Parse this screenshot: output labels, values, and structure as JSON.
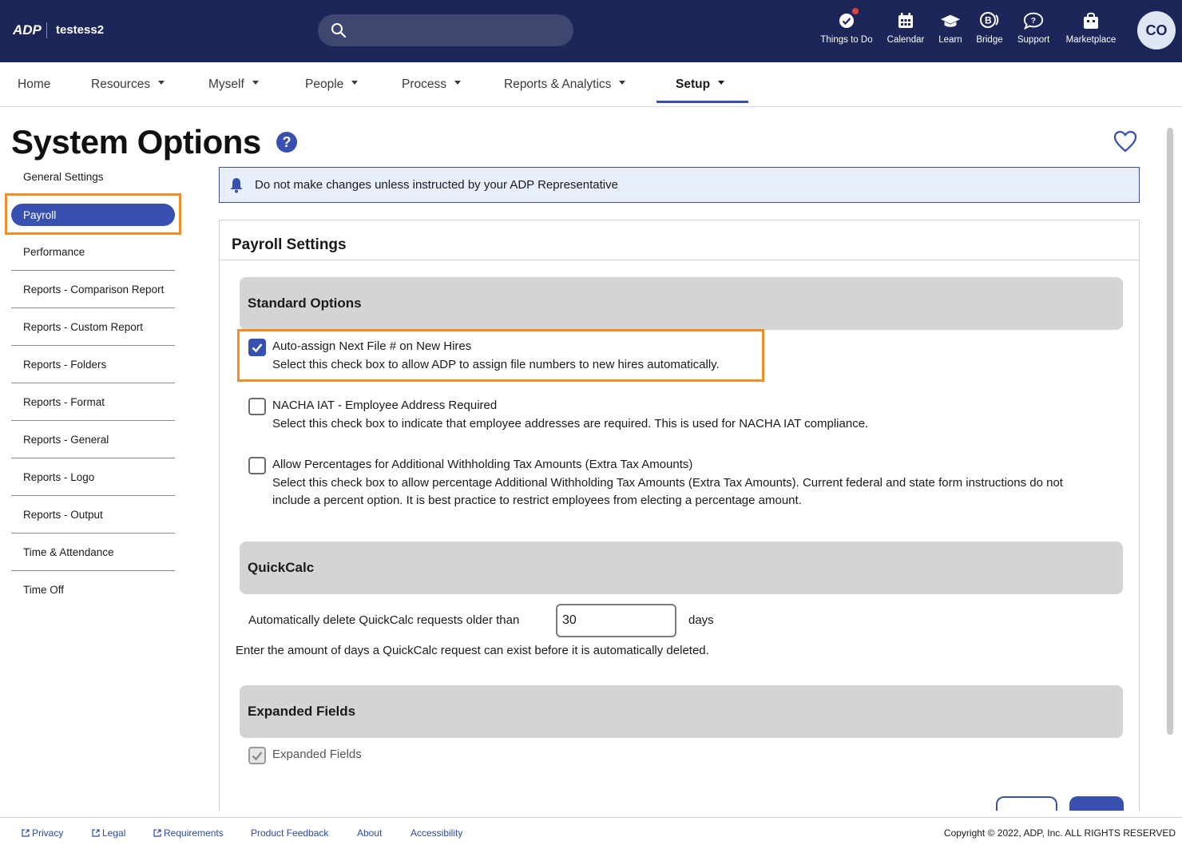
{
  "header": {
    "logo": "ADP",
    "tenant": "testess2",
    "search_placeholder": "",
    "nav": [
      {
        "label": "Things to Do",
        "icon": "things-to-do-icon"
      },
      {
        "label": "Calendar",
        "icon": "calendar-icon"
      },
      {
        "label": "Learn",
        "icon": "graduation-cap-icon"
      },
      {
        "label": "Bridge",
        "icon": "bridge-icon"
      },
      {
        "label": "Support",
        "icon": "support-icon"
      },
      {
        "label": "Marketplace",
        "icon": "marketplace-icon"
      }
    ],
    "avatar": "CO"
  },
  "mainnav": {
    "items": [
      "Home",
      "Resources",
      "Myself",
      "People",
      "Process",
      "Reports & Analytics",
      "Setup"
    ],
    "active": "Setup"
  },
  "page": {
    "title": "System Options",
    "help_icon": "?"
  },
  "sidebar": {
    "items": [
      "General Settings",
      "Payroll",
      "Performance",
      "Reports - Comparison Report",
      "Reports - Custom Report",
      "Reports - Folders",
      "Reports - Format",
      "Reports - General",
      "Reports - Logo",
      "Reports - Output",
      "Time & Attendance",
      "Time Off"
    ],
    "active": "Payroll"
  },
  "alert": {
    "text": "Do not make changes unless instructed by your ADP Representative"
  },
  "panel": {
    "title": "Payroll Settings",
    "standard": {
      "heading": "Standard Options",
      "options": [
        {
          "title": "Auto-assign Next File # on New Hires",
          "desc": "Select this check box to allow ADP to assign file numbers to new hires automatically.",
          "checked": true
        },
        {
          "title": "NACHA IAT - Employee Address Required",
          "desc": "Select this check box to indicate that employee addresses are required. This is used for NACHA IAT compliance.",
          "checked": false
        },
        {
          "title": "Allow Percentages for Additional Withholding Tax Amounts (Extra Tax Amounts)",
          "desc": "Select this check box to allow percentage Additional Withholding Tax Amounts (Extra Tax Amounts). Current federal and state form instructions do not include a percent option. It is best practice to restrict employees from electing a percentage amount.",
          "checked": false
        }
      ]
    },
    "quickcalc": {
      "heading": "QuickCalc",
      "label": "Automatically delete QuickCalc requests older than",
      "value": "30",
      "unit": "days",
      "help": "Enter the amount of days a QuickCalc request can exist before it is automatically deleted."
    },
    "expanded": {
      "heading": "Expanded Fields",
      "label": "Expanded Fields",
      "checked": true,
      "disabled": true
    }
  },
  "footer": {
    "links": [
      "Privacy",
      "Legal",
      "Requirements",
      "Product Feedback",
      "About",
      "Accessibility"
    ],
    "copyright": "Copyright © 2022, ADP, Inc. ALL RIGHTS RESERVED"
  },
  "colors": {
    "header_bg": "#1c2659",
    "accent": "#3851b1",
    "highlight": "#f28c28",
    "section_bg": "#d4d4d4",
    "alert_bg": "#e8eefb"
  }
}
